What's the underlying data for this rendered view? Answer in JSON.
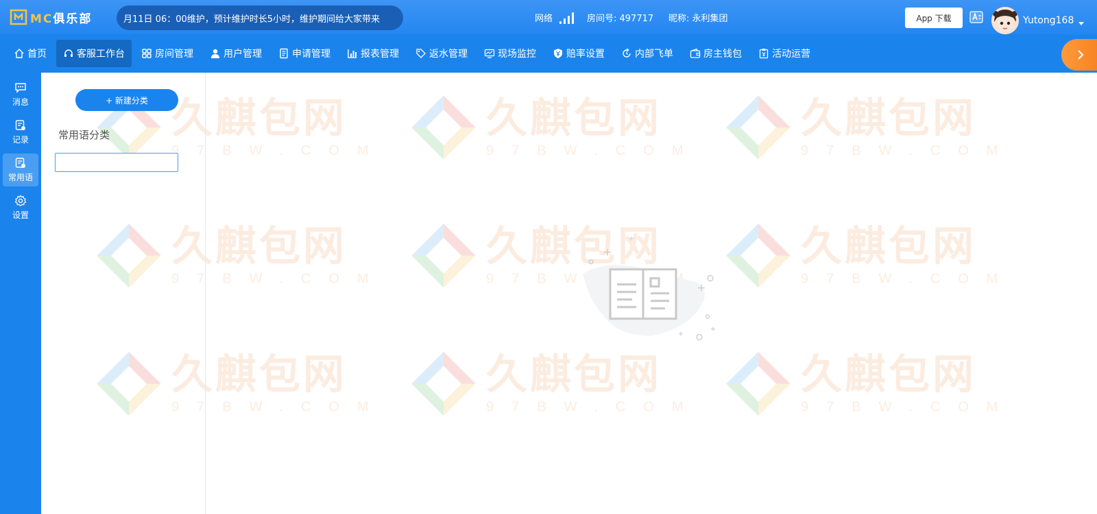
{
  "header": {
    "logo_latin": "MC",
    "logo_cn": "俱乐部",
    "notice": "月11日 06：00维护，预计维护时长5小时，维护期间给大家带来",
    "network_label": "网络",
    "room_label": "房间号: 497717",
    "nick_label": "昵称: 永利集团",
    "app_download": "App 下载",
    "username": "Yutong168"
  },
  "nav": {
    "items": [
      {
        "label": "首页",
        "icon": "home-icon"
      },
      {
        "label": "客服工作台",
        "icon": "headset-icon"
      },
      {
        "label": "房间管理",
        "icon": "grid-icon"
      },
      {
        "label": "用户管理",
        "icon": "user-icon"
      },
      {
        "label": "申请管理",
        "icon": "document-icon"
      },
      {
        "label": "报表管理",
        "icon": "bar-chart-icon"
      },
      {
        "label": "返水管理",
        "icon": "tag-icon"
      },
      {
        "label": "现场监控",
        "icon": "monitor-icon"
      },
      {
        "label": "赔率设置",
        "icon": "shield-yen-icon"
      },
      {
        "label": "内部飞单",
        "icon": "refresh-icon"
      },
      {
        "label": "房主钱包",
        "icon": "wallet-icon"
      },
      {
        "label": "活动运营",
        "icon": "clipboard-yen-icon"
      }
    ],
    "active_index": 1
  },
  "rail": {
    "items": [
      {
        "label": "消息",
        "icon": "chat-icon"
      },
      {
        "label": "记录",
        "icon": "record-icon"
      },
      {
        "label": "常用语",
        "icon": "phrases-icon"
      },
      {
        "label": "设置",
        "icon": "gear-icon"
      }
    ],
    "active_index": 2
  },
  "panel": {
    "new_category_button": "+ 新建分类",
    "category_title": "常用语分类",
    "category_input_value": ""
  },
  "watermark": {
    "cn": "久麒包网",
    "en": "97BW.COM"
  },
  "colors": {
    "header_blue": "#2486f1",
    "nav_blue": "#1b84ec",
    "active_nav": "#1469c2",
    "accent_orange": "#f5801e",
    "logo_gold": "#f3c544"
  }
}
